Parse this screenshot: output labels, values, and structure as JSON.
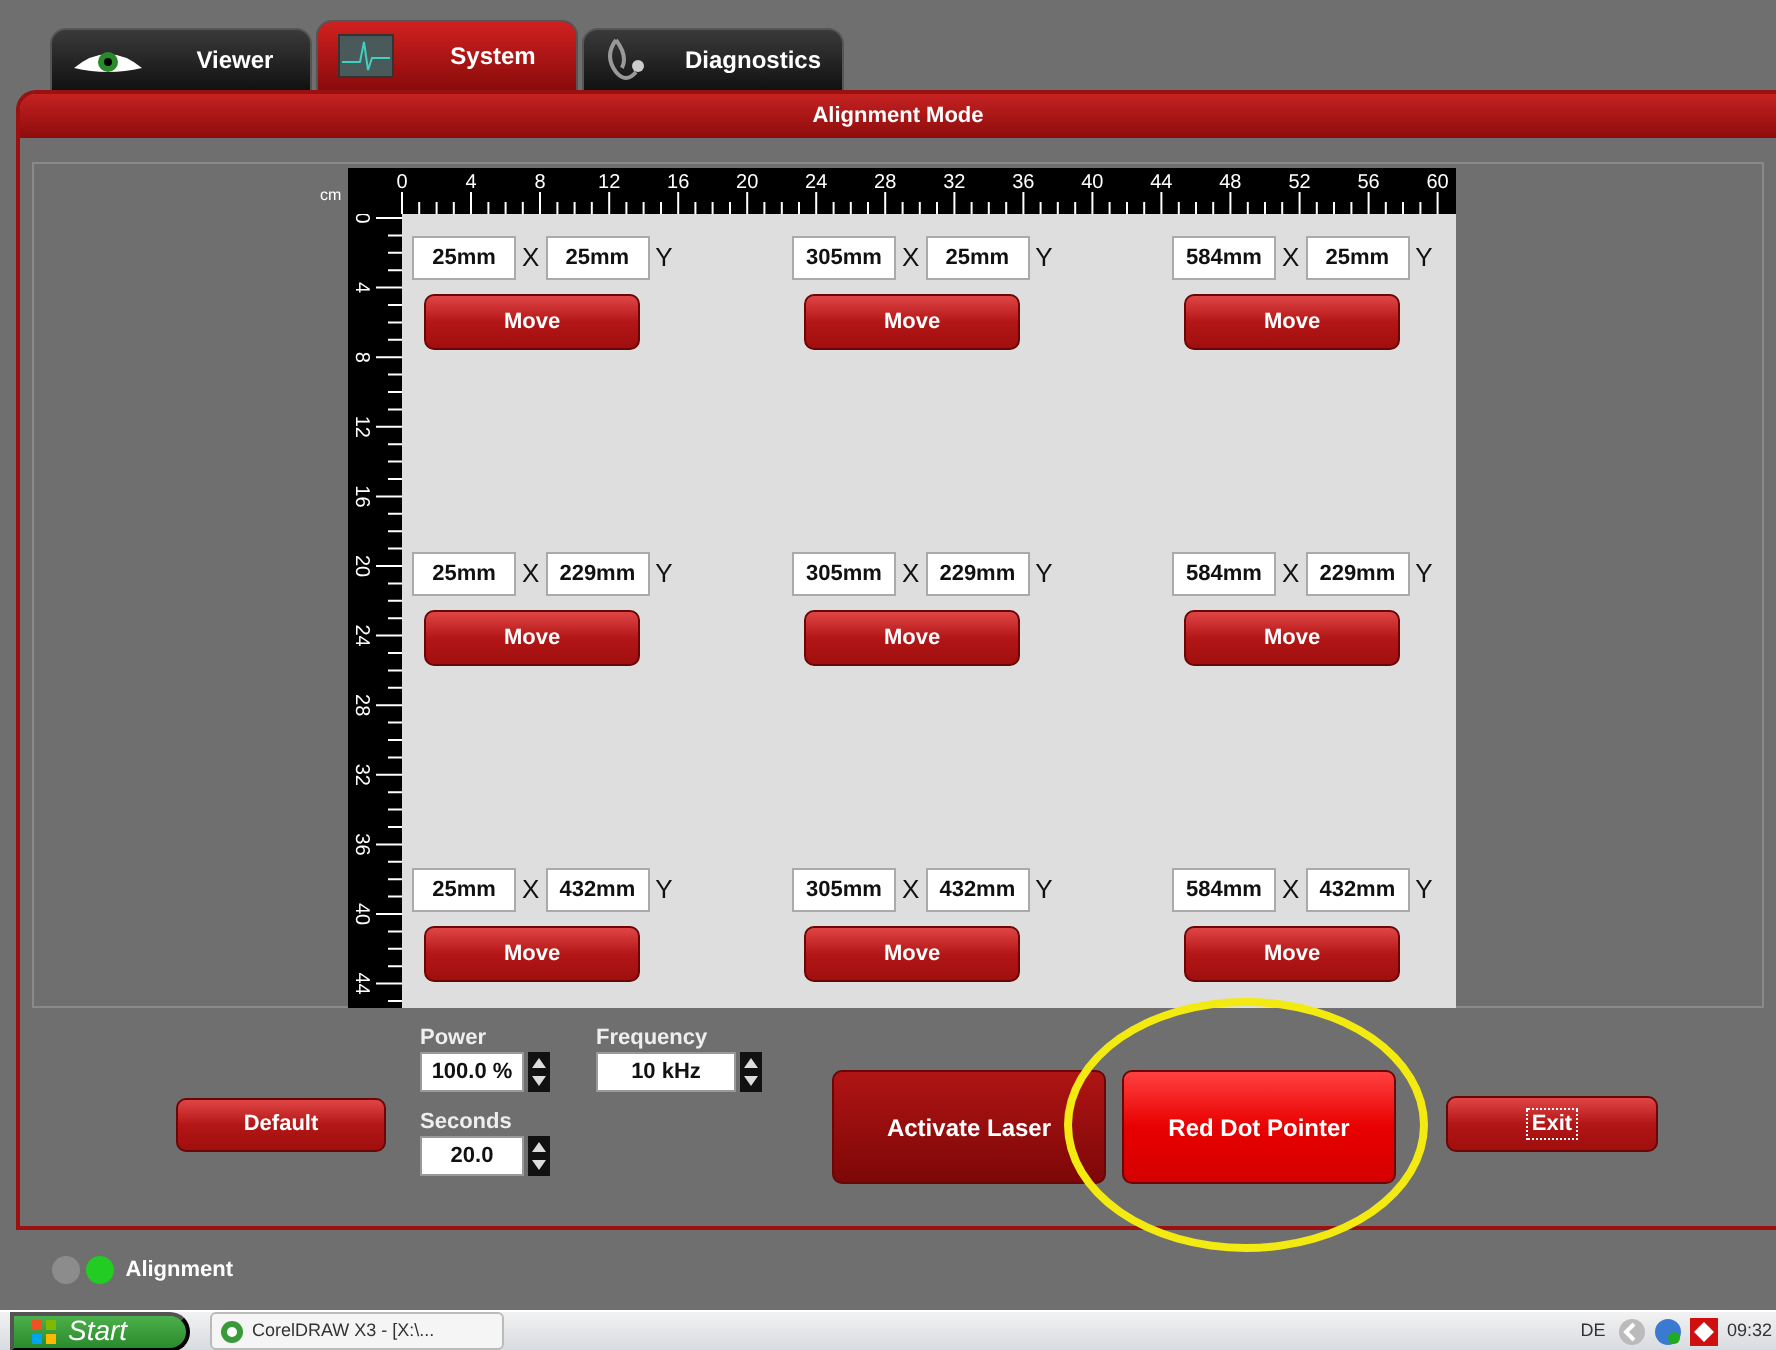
{
  "tabs": [
    {
      "label": "Viewer",
      "kind": "eye",
      "selected": false
    },
    {
      "label": "System",
      "kind": "pulse",
      "selected": true
    },
    {
      "label": "Diagnostics",
      "kind": "stethoscope",
      "selected": false
    }
  ],
  "panel_title": "Alignment Mode",
  "ruler": {
    "unit": "cm",
    "x_labels": [
      "0",
      "4",
      "8",
      "12",
      "16",
      "20",
      "24",
      "28",
      "32",
      "36",
      "40",
      "44",
      "48",
      "52",
      "56",
      "60"
    ],
    "y_labels": [
      "0",
      "4",
      "8",
      "12",
      "16",
      "20",
      "24",
      "28",
      "32",
      "36",
      "40",
      "44"
    ]
  },
  "points": [
    {
      "x": "25mm",
      "x_axis": "X",
      "y": "25mm",
      "y_axis": "Y",
      "button": "Move"
    },
    {
      "x": "305mm",
      "x_axis": "X",
      "y": "25mm",
      "y_axis": "Y",
      "button": "Move"
    },
    {
      "x": "584mm",
      "x_axis": "X",
      "y": "25mm",
      "y_axis": "Y",
      "button": "Move"
    },
    {
      "x": "25mm",
      "x_axis": "X",
      "y": "229mm",
      "y_axis": "Y",
      "button": "Move"
    },
    {
      "x": "305mm",
      "x_axis": "X",
      "y": "229mm",
      "y_axis": "Y",
      "button": "Move"
    },
    {
      "x": "584mm",
      "x_axis": "X",
      "y": "229mm",
      "y_axis": "Y",
      "button": "Move"
    },
    {
      "x": "25mm",
      "x_axis": "X",
      "y": "432mm",
      "y_axis": "Y",
      "button": "Move"
    },
    {
      "x": "305mm",
      "x_axis": "X",
      "y": "432mm",
      "y_axis": "Y",
      "button": "Move"
    },
    {
      "x": "584mm",
      "x_axis": "X",
      "y": "432mm",
      "y_axis": "Y",
      "button": "Move"
    }
  ],
  "default_button": "Default",
  "settings": {
    "power": {
      "label": "Power",
      "value": "100.0 %"
    },
    "seconds": {
      "label": "Seconds",
      "value": "20.0"
    },
    "frequency": {
      "label": "Frequency",
      "value": "10 kHz"
    }
  },
  "actions": [
    {
      "label": "Activate Laser",
      "active": false,
      "focused": false,
      "highlighted": false
    },
    {
      "label": "Red Dot Pointer",
      "active": true,
      "focused": false,
      "highlighted": true
    },
    {
      "label": "Exit",
      "active": false,
      "focused": true,
      "highlighted": false
    }
  ],
  "status": {
    "lights": [
      {
        "color": "#8c8c8c"
      },
      {
        "color": "#22cc22"
      }
    ],
    "label": "Alignment"
  },
  "taskbar": {
    "start": "Start",
    "tasks": [
      "CorelDRAW X3 - [X:\\..."
    ],
    "language": "DE",
    "clock": "09:32"
  }
}
